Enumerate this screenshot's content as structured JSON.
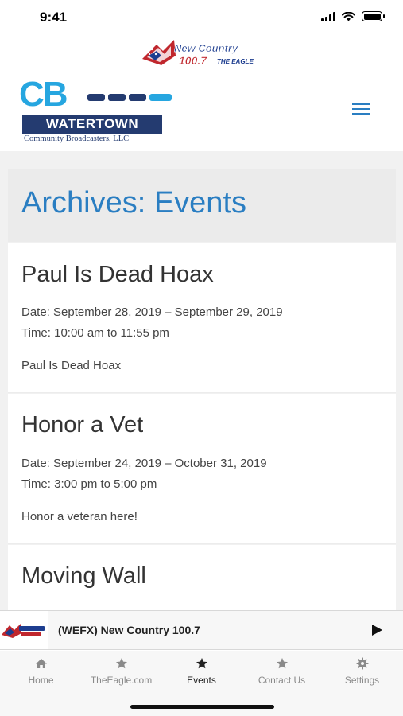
{
  "status_bar": {
    "time": "9:41"
  },
  "station_logo": {
    "line1": "New Country",
    "line2": "100.7",
    "line3": "THE EAGLE"
  },
  "brand": {
    "mark": "CB",
    "name": "WATERTOWN",
    "tagline": "Community Broadcasters, LLC"
  },
  "archive": {
    "title": "Archives: Events"
  },
  "events": [
    {
      "title": "Paul Is Dead Hoax",
      "date": "Date: September 28, 2019 – September 29, 2019",
      "time": "Time: 10:00 am to 11:55 pm",
      "description": "Paul Is Dead Hoax"
    },
    {
      "title": "Honor a Vet",
      "date": "Date: September 24, 2019 – October 31, 2019",
      "time": "Time: 3:00 pm to 5:00 pm",
      "description": "Honor a veteran here!"
    },
    {
      "title": "Moving Wall"
    }
  ],
  "player": {
    "title": "(WEFX) New Country 100.7"
  },
  "tabs": [
    {
      "label": "Home",
      "icon": "home-icon"
    },
    {
      "label": "TheEagle.com",
      "icon": "star-icon"
    },
    {
      "label": "Events",
      "icon": "star-icon",
      "active": true
    },
    {
      "label": "Contact Us",
      "icon": "star-icon"
    },
    {
      "label": "Settings",
      "icon": "gear-icon"
    }
  ],
  "colors": {
    "accent": "#2a7ec2",
    "brand_blue": "#26a6e0",
    "brand_navy": "#243b70",
    "tab_inactive": "#8a8a8a"
  }
}
